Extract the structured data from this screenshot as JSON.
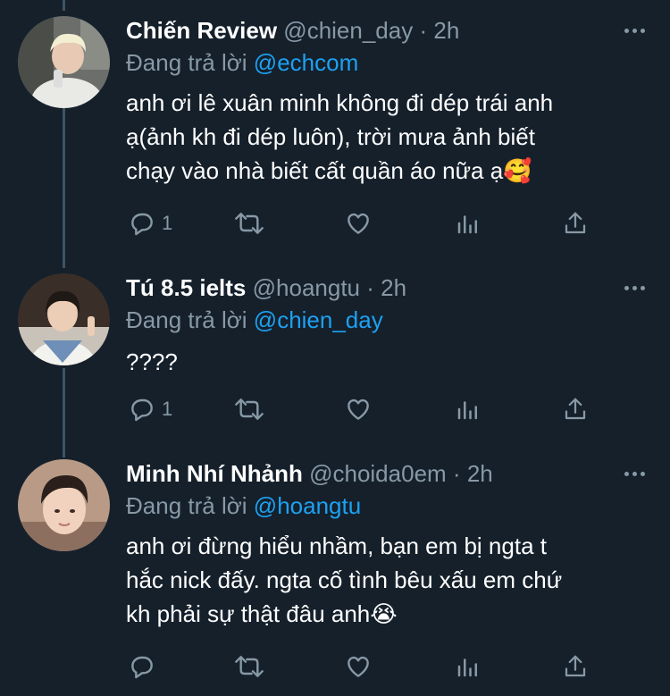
{
  "tweets": [
    {
      "name": "Chiến Review",
      "handle": "@chien_day",
      "dot": "·",
      "time": "2h",
      "replying_label": "Đang trả lời",
      "replying_to": "@echcom",
      "text_lines": [
        "anh ơi lê xuân minh không đi dép trái anh",
        "ạ(ảnh kh đi dép luôn), trời mưa ảnh biết",
        "chạy vào nhà biết cất quần áo nữa ạ🥰"
      ],
      "reply_count": "1"
    },
    {
      "name": "Tú 8.5 ielts",
      "handle": "@hoangtu",
      "dot": "·",
      "time": "2h",
      "replying_label": "Đang trả lời",
      "replying_to": "@chien_day",
      "text_lines": [
        "????"
      ],
      "reply_count": "1"
    },
    {
      "name": "Minh Nhí Nhảnh",
      "handle": "@choida0em",
      "dot": "·",
      "time": "2h",
      "replying_label": "Đang trả lời",
      "replying_to": "@hoangtu",
      "text_lines": [
        "anh ơi đừng hiểu nhầm, bạn em bị ngta t",
        "hắc nick đấy. ngta cố tình bêu xấu em chứ",
        "kh phải sự thật đâu anh😭"
      ],
      "reply_count": ""
    }
  ],
  "colors": {
    "background": "#15202b",
    "secondary_text": "#8899a6",
    "accent": "#1da1f2",
    "thread_line": "#3d5466"
  },
  "icons": [
    "reply-icon",
    "retweet-icon",
    "like-icon",
    "analytics-icon",
    "share-icon",
    "more-icon"
  ]
}
